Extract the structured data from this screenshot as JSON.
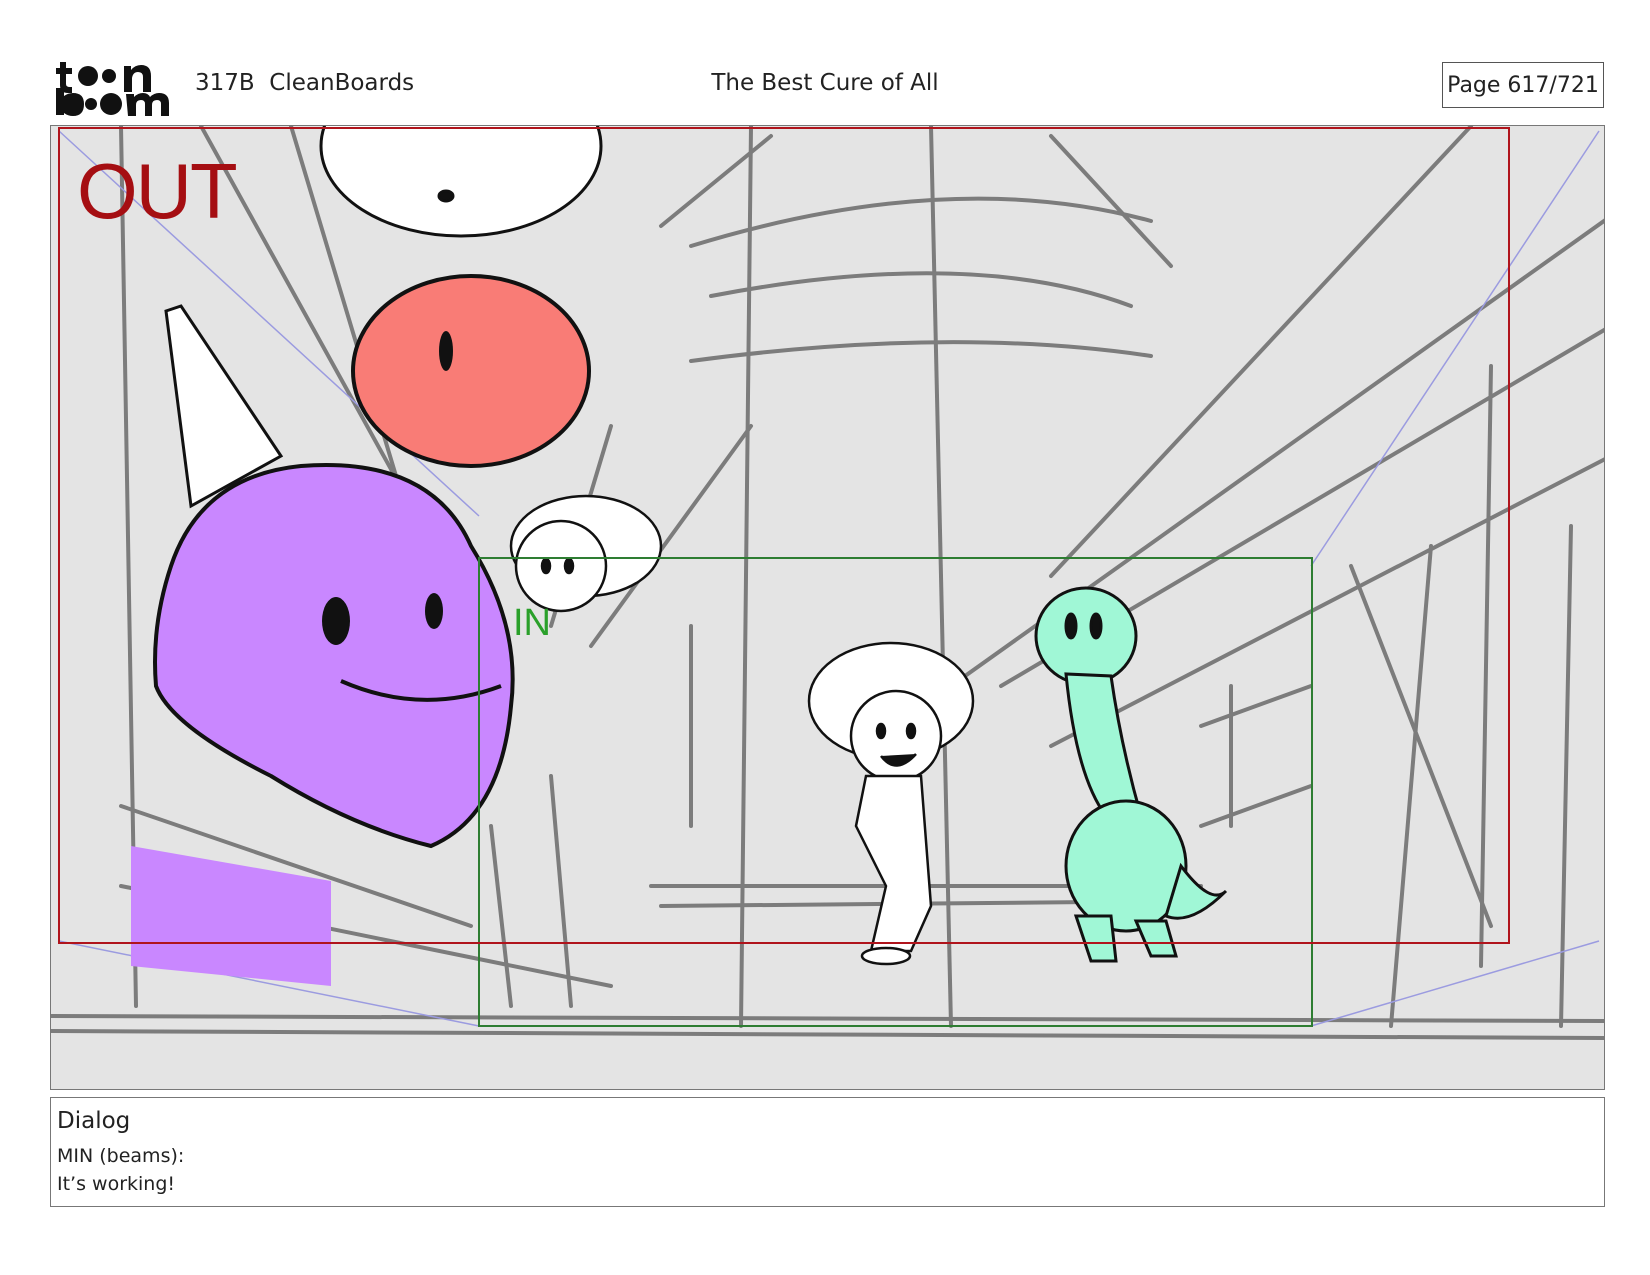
{
  "header": {
    "logo_text": "toon boom",
    "episode": "317B  CleanBoards",
    "title": "The Best Cure of All",
    "page_label": "Page 617/721"
  },
  "panel": {
    "out_label": "OUT",
    "in_label": "IN",
    "colors": {
      "out_frame": "#b0141c",
      "in_frame": "#2e7d32",
      "guide": "#9b9be0",
      "background": "#e4e4e4",
      "sketch": "#6a6a6a",
      "purple_character": "#c987ff",
      "red_character": "#f97c76",
      "green_character": "#a0f7d6"
    }
  },
  "dialog": {
    "heading": "Dialog",
    "lines": [
      "MIN (beams):",
      "It’s working!"
    ]
  }
}
